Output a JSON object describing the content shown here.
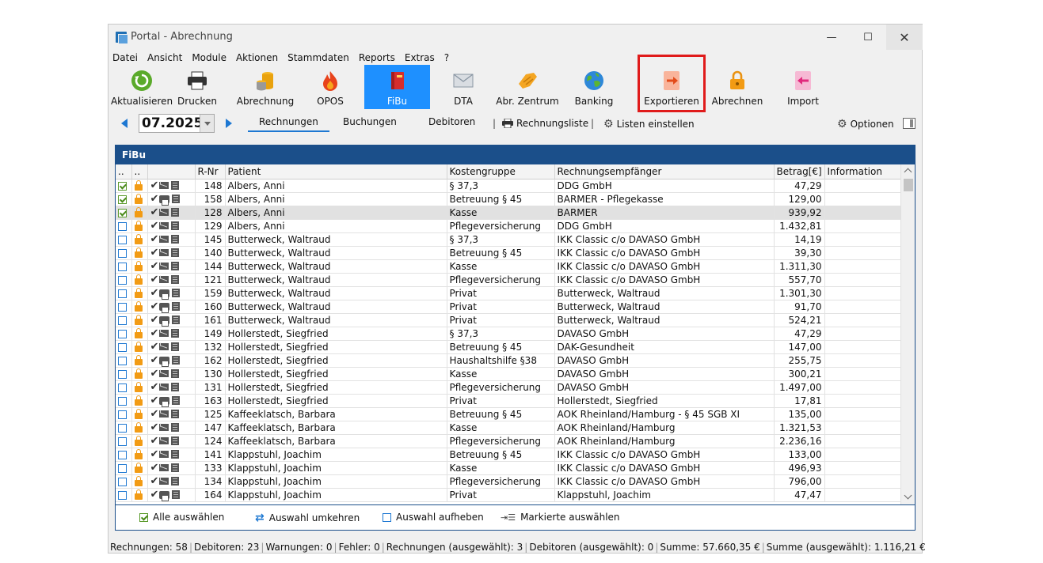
{
  "window": {
    "title": "Portal - Abrechnung",
    "min": "—",
    "max": "☐",
    "close": "✕"
  },
  "menu": [
    "Datei",
    "Ansicht",
    "Module",
    "Aktionen",
    "Stammdaten",
    "Reports",
    "Extras",
    "?"
  ],
  "toolbar": {
    "aktualisieren": "Aktualisieren",
    "drucken": "Drucken",
    "abrechnung": "Abrechnung",
    "opos": "OPOS",
    "fibu": "FiBu",
    "dta": "DTA",
    "abr_zentrum": "Abr. Zentrum",
    "banking": "Banking",
    "exportieren": "Exportieren",
    "abrechnen": "Abrechnen",
    "import": "Import"
  },
  "nav": {
    "period": "07.2025",
    "tabs": [
      "Rechnungen",
      "Buchungen",
      "Debitoren"
    ],
    "sep": "|",
    "rechnungsliste": "Rechnungsliste",
    "listen_einstellen": "Listen einstellen",
    "optionen": "Optionen"
  },
  "panel": {
    "title": "FiBu",
    "columns": [
      "..",
      "..",
      "",
      "R-Nr",
      "Patient",
      "Kostengruppe",
      "Rechnungsempfänger",
      "Betrag[€]",
      "Information"
    ],
    "rows": [
      {
        "checked": true,
        "icon": "mail",
        "nr": "148",
        "patient": "Albers, Anni",
        "kg": "§ 37,3",
        "empf": "DDG GmbH",
        "betrag": "47,29"
      },
      {
        "checked": true,
        "icon": "printer",
        "nr": "158",
        "patient": "Albers, Anni",
        "kg": "Betreuung § 45",
        "empf": "BARMER - Pflegekasse",
        "betrag": "129,00"
      },
      {
        "checked": true,
        "icon": "mail",
        "nr": "128",
        "patient": "Albers, Anni",
        "kg": "Kasse",
        "empf": "BARMER",
        "betrag": "939,92",
        "selected": true
      },
      {
        "checked": false,
        "icon": "mail",
        "nr": "129",
        "patient": "Albers, Anni",
        "kg": "Pflegeversicherung",
        "empf": "DDG GmbH",
        "betrag": "1.432,81"
      },
      {
        "checked": false,
        "icon": "mail",
        "nr": "145",
        "patient": "Butterweck, Waltraud",
        "kg": "§ 37,3",
        "empf": "IKK Classic c/o DAVASO GmbH",
        "betrag": "14,19"
      },
      {
        "checked": false,
        "icon": "mail",
        "nr": "140",
        "patient": "Butterweck, Waltraud",
        "kg": "Betreuung § 45",
        "empf": "IKK Classic c/o DAVASO GmbH",
        "betrag": "39,30"
      },
      {
        "checked": false,
        "icon": "mail",
        "nr": "144",
        "patient": "Butterweck, Waltraud",
        "kg": "Kasse",
        "empf": "IKK Classic c/o DAVASO GmbH",
        "betrag": "1.311,30"
      },
      {
        "checked": false,
        "icon": "mail",
        "nr": "121",
        "patient": "Butterweck, Waltraud",
        "kg": "Pflegeversicherung",
        "empf": "IKK Classic c/o DAVASO GmbH",
        "betrag": "557,70"
      },
      {
        "checked": false,
        "icon": "printer",
        "nr": "159",
        "patient": "Butterweck, Waltraud",
        "kg": "Privat",
        "empf": "Butterweck, Waltraud",
        "betrag": "1.301,30"
      },
      {
        "checked": false,
        "icon": "printer",
        "nr": "160",
        "patient": "Butterweck, Waltraud",
        "kg": "Privat",
        "empf": "Butterweck, Waltraud",
        "betrag": "91,70"
      },
      {
        "checked": false,
        "icon": "printer",
        "nr": "161",
        "patient": "Butterweck, Waltraud",
        "kg": "Privat",
        "empf": "Butterweck, Waltraud",
        "betrag": "524,21"
      },
      {
        "checked": false,
        "icon": "mail",
        "nr": "149",
        "patient": "Hollerstedt, Siegfried",
        "kg": "§ 37,3",
        "empf": "DAVASO GmbH",
        "betrag": "47,29"
      },
      {
        "checked": false,
        "icon": "mail",
        "nr": "132",
        "patient": "Hollerstedt, Siegfried",
        "kg": "Betreuung § 45",
        "empf": "DAK-Gesundheit",
        "betrag": "147,00"
      },
      {
        "checked": false,
        "icon": "printer",
        "nr": "162",
        "patient": "Hollerstedt, Siegfried",
        "kg": "Haushaltshilfe §38",
        "empf": "DAVASO GmbH",
        "betrag": "255,75"
      },
      {
        "checked": false,
        "icon": "mail",
        "nr": "130",
        "patient": "Hollerstedt, Siegfried",
        "kg": "Kasse",
        "empf": "DAVASO GmbH",
        "betrag": "300,21"
      },
      {
        "checked": false,
        "icon": "mail",
        "nr": "131",
        "patient": "Hollerstedt, Siegfried",
        "kg": "Pflegeversicherung",
        "empf": "DAVASO GmbH",
        "betrag": "1.497,00"
      },
      {
        "checked": false,
        "icon": "printer",
        "nr": "163",
        "patient": "Hollerstedt, Siegfried",
        "kg": "Privat",
        "empf": "Hollerstedt, Siegfried",
        "betrag": "17,81"
      },
      {
        "checked": false,
        "icon": "mail",
        "nr": "125",
        "patient": "Kaffeeklatsch, Barbara",
        "kg": "Betreuung § 45",
        "empf": "AOK Rheinland/Hamburg - § 45 SGB XI",
        "betrag": "135,00"
      },
      {
        "checked": false,
        "icon": "mail",
        "nr": "147",
        "patient": "Kaffeeklatsch, Barbara",
        "kg": "Kasse",
        "empf": "AOK Rheinland/Hamburg",
        "betrag": "1.321,53"
      },
      {
        "checked": false,
        "icon": "mail",
        "nr": "124",
        "patient": "Kaffeeklatsch, Barbara",
        "kg": "Pflegeversicherung",
        "empf": "AOK Rheinland/Hamburg",
        "betrag": "2.236,16"
      },
      {
        "checked": false,
        "icon": "mail",
        "nr": "141",
        "patient": "Klappstuhl, Joachim",
        "kg": "Betreuung § 45",
        "empf": "IKK Classic c/o DAVASO GmbH",
        "betrag": "133,00"
      },
      {
        "checked": false,
        "icon": "mail",
        "nr": "133",
        "patient": "Klappstuhl, Joachim",
        "kg": "Kasse",
        "empf": "IKK Classic c/o DAVASO GmbH",
        "betrag": "496,93"
      },
      {
        "checked": false,
        "icon": "mail",
        "nr": "134",
        "patient": "Klappstuhl, Joachim",
        "kg": "Pflegeversicherung",
        "empf": "IKK Classic c/o DAVASO GmbH",
        "betrag": "796,00"
      },
      {
        "checked": false,
        "icon": "printer",
        "nr": "164",
        "patient": "Klappstuhl, Joachim",
        "kg": "Privat",
        "empf": "Klappstuhl, Joachim",
        "betrag": "47,47"
      }
    ],
    "footer": {
      "select_all": "Alle auswählen",
      "invert": "Auswahl umkehren",
      "clear": "Auswahl aufheben",
      "select_marked": "Markierte auswählen"
    }
  },
  "status": {
    "rechnungen": "Rechnungen: 58",
    "debitoren": "Debitoren: 23",
    "warnungen": "Warnungen: 0",
    "fehler": "Fehler: 0",
    "rechnungen_sel": "Rechnungen (ausgewählt): 3",
    "debitoren_sel": "Debitoren (ausgewählt): 0",
    "summe": "Summe: 57.660,35 €",
    "summe_sel": "Summe (ausgewählt): 1.116,21 €"
  },
  "colors": {
    "accent": "#1e90ff",
    "panel_header": "#1b4f8a",
    "highlight_box": "#e01b1b"
  }
}
